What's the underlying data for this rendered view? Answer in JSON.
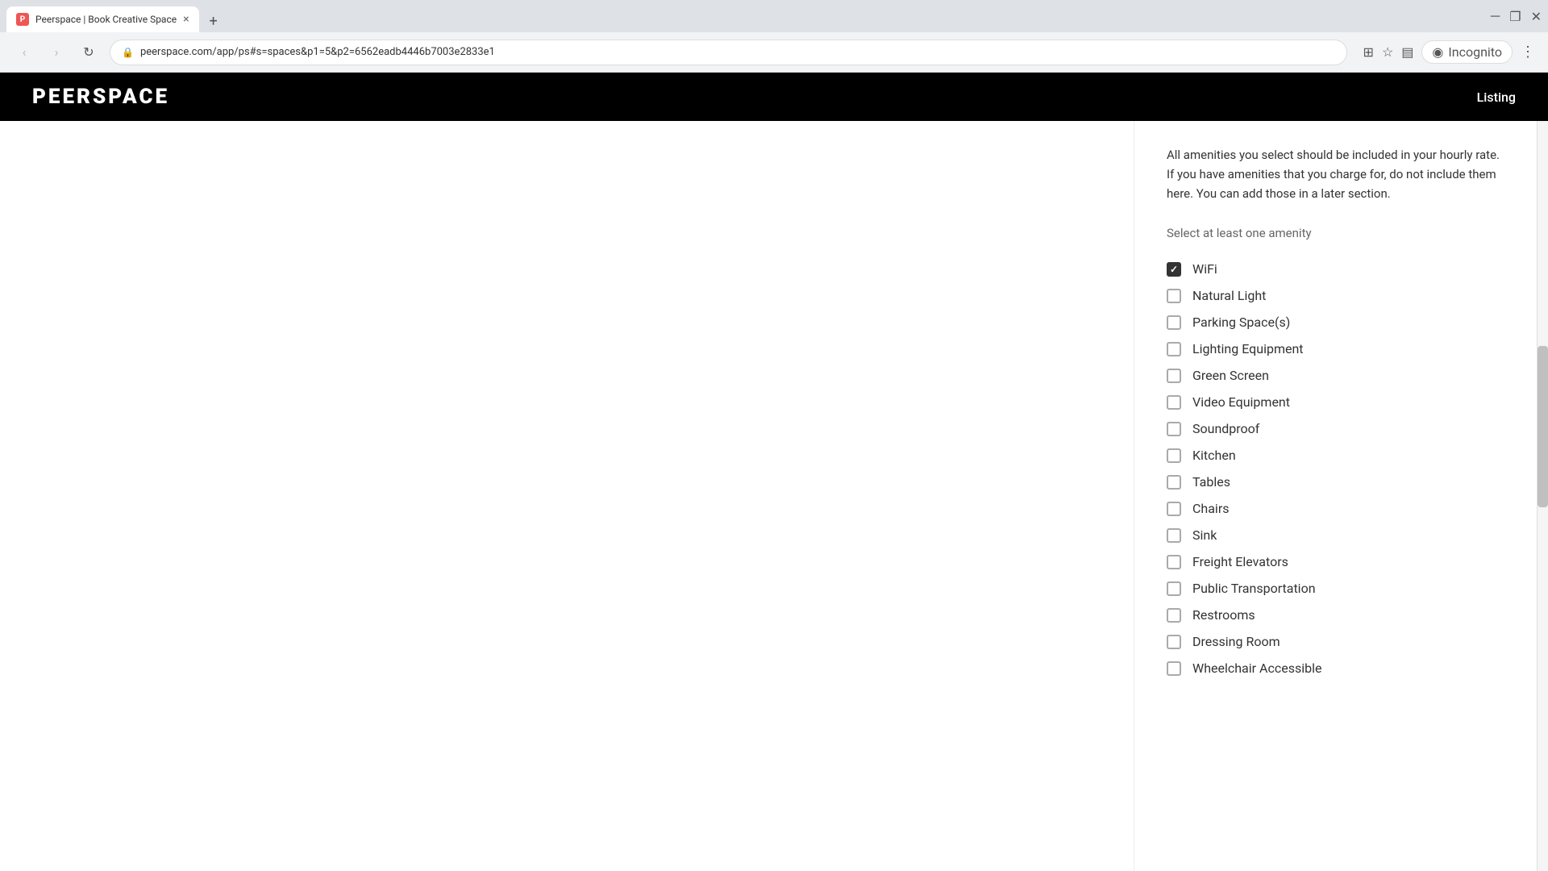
{
  "browser": {
    "tab": {
      "favicon": "P",
      "title": "Peerspace | Book Creative Space",
      "close": "×"
    },
    "new_tab": "+",
    "window_controls": {
      "minimize": "─",
      "maximize": "❐",
      "close": "✕"
    },
    "nav": {
      "back": "←",
      "forward": "→",
      "refresh": "↻"
    },
    "url": "peerspace.com/app/ps#s=spaces&p1=5&p2=6562eadb4446b7003e2833e1",
    "toolbar_icons": {
      "screen_search": "⊞",
      "star": "☆",
      "profile": "◉"
    },
    "incognito": "Incognito"
  },
  "site": {
    "logo": "PEERSPACE",
    "nav_listing": "Listing"
  },
  "main": {
    "description": "All amenities you select should be included in your hourly rate. If you have amenities that you charge for, do not include them here. You can add those in a later section.",
    "select_label": "Select at least one amenity",
    "amenities": [
      {
        "id": "wifi",
        "label": "WiFi",
        "checked": true
      },
      {
        "id": "natural-light",
        "label": "Natural Light",
        "checked": false
      },
      {
        "id": "parking-spaces",
        "label": "Parking Space(s)",
        "checked": false
      },
      {
        "id": "lighting-equipment",
        "label": "Lighting Equipment",
        "checked": false
      },
      {
        "id": "green-screen",
        "label": "Green Screen",
        "checked": false
      },
      {
        "id": "video-equipment",
        "label": "Video Equipment",
        "checked": false
      },
      {
        "id": "soundproof",
        "label": "Soundproof",
        "checked": false
      },
      {
        "id": "kitchen",
        "label": "Kitchen",
        "checked": false
      },
      {
        "id": "tables",
        "label": "Tables",
        "checked": false
      },
      {
        "id": "chairs",
        "label": "Chairs",
        "checked": false
      },
      {
        "id": "sink",
        "label": "Sink",
        "checked": false
      },
      {
        "id": "freight-elevators",
        "label": "Freight Elevators",
        "checked": false
      },
      {
        "id": "public-transportation",
        "label": "Public Transportation",
        "checked": false
      },
      {
        "id": "restrooms",
        "label": "Restrooms",
        "checked": false
      },
      {
        "id": "dressing-room",
        "label": "Dressing Room",
        "checked": false
      },
      {
        "id": "wheelchair-accessible",
        "label": "Wheelchair Accessible",
        "checked": false
      }
    ]
  }
}
